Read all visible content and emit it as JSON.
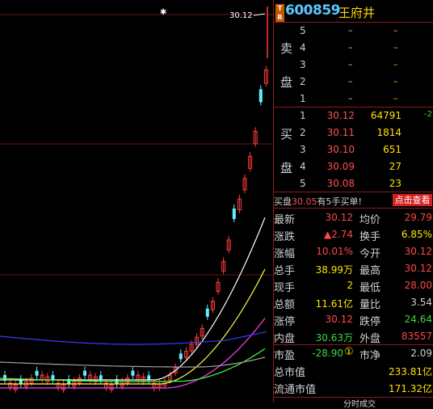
{
  "chart": {
    "price_marker": "30.12",
    "star": "✱"
  },
  "quote": {
    "badge": "T\nR",
    "code": "600859",
    "name": "王府井",
    "sell_side_label": [
      "卖",
      "盘"
    ],
    "buy_side_label": [
      "买",
      "盘"
    ],
    "sell_levels": [
      {
        "level": "5",
        "price": "–",
        "volume": "–"
      },
      {
        "level": "4",
        "price": "–",
        "volume": "–"
      },
      {
        "level": "3",
        "price": "–",
        "volume": "–"
      },
      {
        "level": "2",
        "price": "–",
        "volume": "–"
      },
      {
        "level": "1",
        "price": "–",
        "volume": "–"
      }
    ],
    "buy_levels": [
      {
        "level": "1",
        "price": "30.12",
        "volume": "64791",
        "delta": "-2"
      },
      {
        "level": "2",
        "price": "30.11",
        "volume": "1814",
        "delta": ""
      },
      {
        "level": "3",
        "price": "30.10",
        "volume": "651",
        "delta": ""
      },
      {
        "level": "4",
        "price": "30.09",
        "volume": "27",
        "delta": ""
      },
      {
        "level": "5",
        "price": "30.08",
        "volume": "23",
        "delta": ""
      }
    ],
    "notice_prefix": "买盘",
    "notice_price": "30.05",
    "notice_suffix": "有5手买单!",
    "click_button": "点击查看",
    "stats": [
      {
        "l1": "最新",
        "v1": "30.12",
        "c1": "red",
        "l2": "均价",
        "v2": "29.79",
        "c2": "red"
      },
      {
        "l1": "涨跌",
        "v1": "▲2.74",
        "c1": "red",
        "l2": "换手",
        "v2": "6.85%",
        "c2": "yel"
      },
      {
        "l1": "涨幅",
        "v1": "10.01%",
        "c1": "red",
        "l2": "今开",
        "v2": "30.12",
        "c2": "red"
      },
      {
        "l1": "总手",
        "v1": "38.99万",
        "c1": "yel",
        "l2": "最高",
        "v2": "30.12",
        "c2": "red"
      },
      {
        "l1": "现手",
        "v1": "2",
        "c1": "yel",
        "l2": "最低",
        "v2": "28.00",
        "c2": "red"
      },
      {
        "l1": "总额",
        "v1": "11.61亿",
        "c1": "yel",
        "l2": "量比",
        "v2": "3.54",
        "c2": "wht"
      },
      {
        "l1": "涨停",
        "v1": "30.12",
        "c1": "red",
        "l2": "跌停",
        "v2": "24.64",
        "c2": "grn"
      },
      {
        "l1": "内盘",
        "v1": "30.63万",
        "c1": "grn",
        "l2": "外盘",
        "v2": "83557",
        "c2": "red"
      }
    ],
    "pe_label": "市盈",
    "pe_value": "-28.90",
    "pe_circle": "①",
    "pb_label": "市净",
    "pb_value": "2.09",
    "mcap_label": "总市值",
    "mcap_value": "233.81亿",
    "float_label": "流通市值",
    "float_value": "171.32亿",
    "bottom_tab": "分时成交"
  }
}
